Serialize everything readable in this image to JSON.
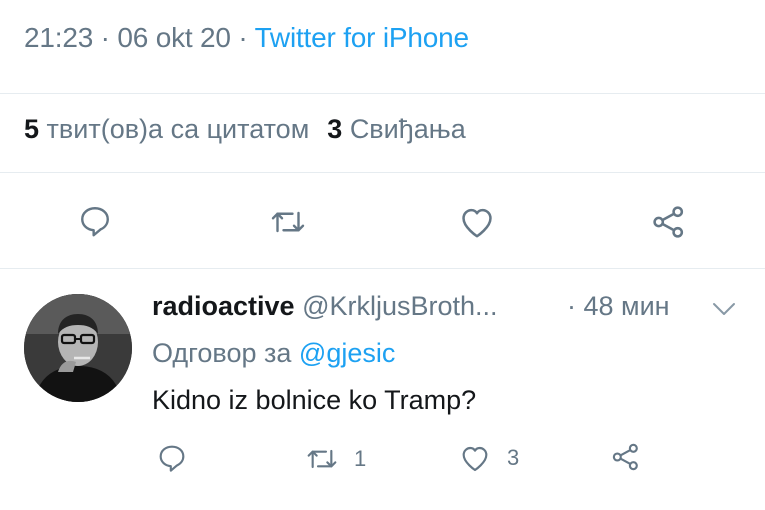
{
  "tweet": {
    "time": "21:23",
    "sep1": " · ",
    "date": "06 okt 20",
    "sep2": " · ",
    "source": "Twitter for iPhone"
  },
  "stats": {
    "quotes_count": "5",
    "quotes_label": "твит(ов)а са цитатом",
    "likes_count": "3",
    "likes_label": "Свиђања"
  },
  "actions": [
    "reply-icon",
    "retweet-icon",
    "like-icon",
    "share-icon"
  ],
  "reply": {
    "display_name": "radioactive",
    "handle": "@KrkljusBroth...",
    "time": "· 48 мин",
    "replying_prefix": "Одговор за ",
    "replying_to": "@gjesic",
    "text": "Kidno iz bolnice ko Tramp?",
    "retweet_count": "1",
    "like_count": "3"
  },
  "colors": {
    "accent": "#1da1f2",
    "secondary_text": "#657786",
    "primary_text": "#14171a",
    "divider": "#e6ecf0"
  }
}
